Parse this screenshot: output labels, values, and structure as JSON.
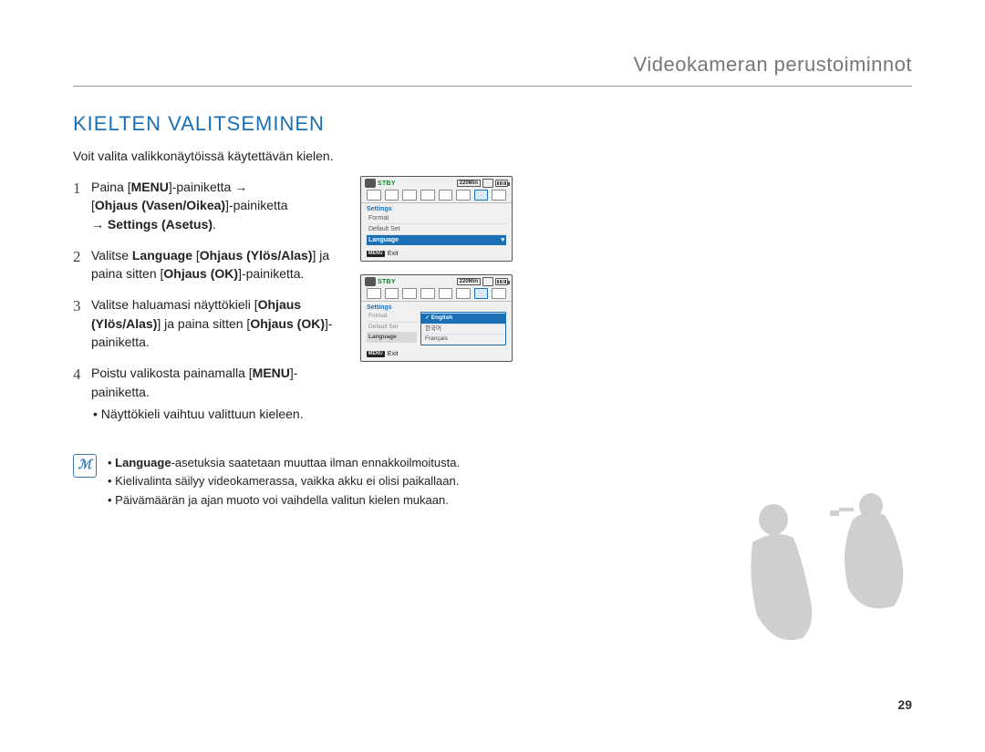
{
  "header": {
    "breadcrumb": "Videokameran perustoiminnot"
  },
  "section": {
    "title": "KIELTEN VALITSEMINEN",
    "intro": "Voit valita valikkonäytöissä käytettävän kielen."
  },
  "steps": {
    "s1": {
      "num": "1",
      "part_a": "Paina [",
      "bold_a": "MENU",
      "part_b": "]-painiketta ",
      "arrow1": "→",
      "line2_a": "[",
      "bold_b": "Ohjaus (Vasen/Oikea)",
      "line2_b": "]-painiketta ",
      "arrow2": "→",
      "bold_c": " Settings (Asetus)",
      "line3_end": "."
    },
    "s2": {
      "num": "2",
      "a": "Valitse ",
      "b1": "Language",
      "mid": " [",
      "b2": "Ohjaus (Ylös/Alas)",
      "c": "] ja paina sitten [",
      "b3": "Ohjaus (OK)",
      "d": "]-painiketta."
    },
    "s3": {
      "num": "3",
      "a": "Valitse haluamasi näyttökieli [",
      "b1": "Ohjaus (Ylös/Alas)",
      "b": "] ja paina sitten [",
      "b2": "Ohjaus (OK)",
      "c": "]-painiketta."
    },
    "s4": {
      "num": "4",
      "a": "Poistu valikosta painamalla [",
      "b1": "MENU",
      "b": "]-painiketta.",
      "sub": "Näyttökieli vaihtuu valittuun kieleen."
    }
  },
  "lcd": {
    "stby": "STBY",
    "time": "220Min",
    "settings": "Settings",
    "format": "Format",
    "default_set": "Default Set",
    "language": "Language",
    "menu_chip": "MENU",
    "exit": "Exit",
    "lang_en": "English",
    "lang_ko": "한국어",
    "lang_fr": "Français"
  },
  "notes": {
    "n1a": "Language",
    "n1b": "-asetuksia saatetaan muuttaa ilman ennakkoilmoitusta.",
    "n2": "Kielivalinta säilyy videokamerassa, vaikka akku ei olisi paikallaan.",
    "n3": "Päivämäärän ja ajan muoto voi vaihdella valitun kielen mukaan."
  },
  "page_number": "29"
}
